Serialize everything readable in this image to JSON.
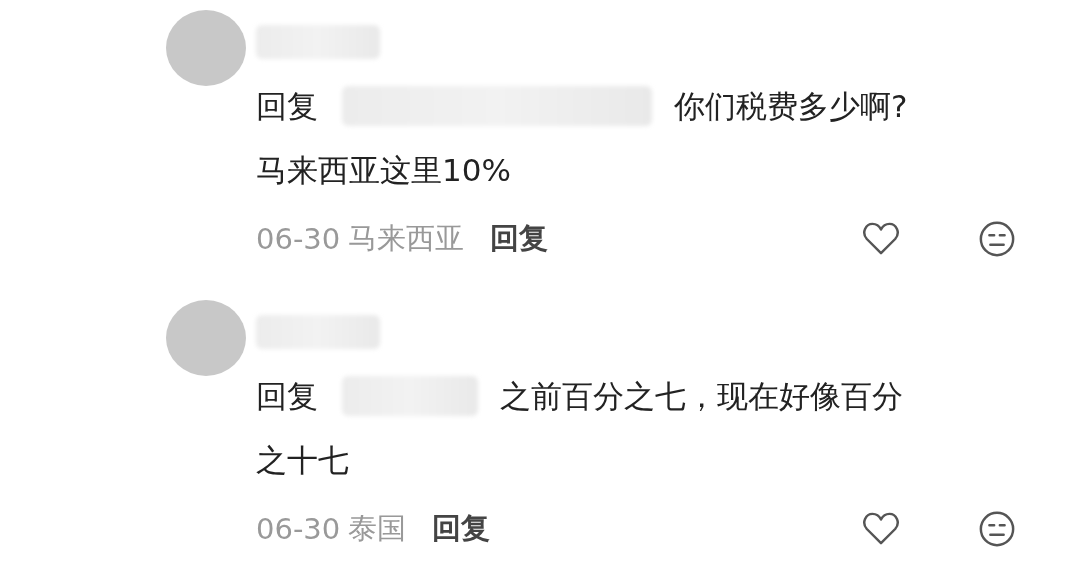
{
  "comments": [
    {
      "reply_prefix": "回复",
      "text_lines": [
        "你们税费多少啊?",
        "马来西亚这里10%"
      ],
      "date": "06-30",
      "location": "马来西亚",
      "reply_button": "回复",
      "liked": false
    },
    {
      "reply_prefix": "回复",
      "text_lines": [
        "之前百分之七，现在好像百分",
        "之十七"
      ],
      "date": "06-30",
      "location": "泰国",
      "reply_button": "回复",
      "liked": false
    }
  ]
}
